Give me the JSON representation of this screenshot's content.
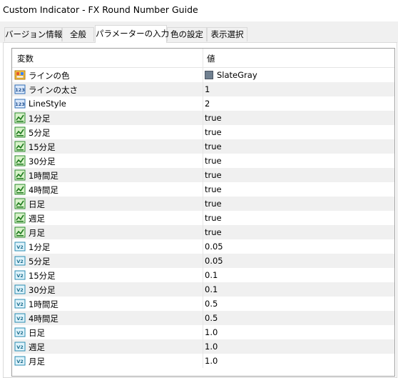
{
  "window": {
    "title": "Custom Indicator - FX Round Number Guide"
  },
  "tabs": [
    {
      "label": "バージョン情報"
    },
    {
      "label": "全般"
    },
    {
      "label": "パラメーターの入力"
    },
    {
      "label": "色の設定"
    },
    {
      "label": "表示選択"
    }
  ],
  "table": {
    "col_variable": "変数",
    "col_value": "値",
    "rows": [
      {
        "name": "ラインの色",
        "value": "SlateGray",
        "icon": "color-icon",
        "swatch": "#708090"
      },
      {
        "name": "ラインの太さ",
        "value": "1",
        "icon": "integer-icon"
      },
      {
        "name": "LineStyle",
        "value": "2",
        "icon": "integer-icon"
      },
      {
        "name": "1分足",
        "value": "true",
        "icon": "boolean-icon"
      },
      {
        "name": "5分足",
        "value": "true",
        "icon": "boolean-icon"
      },
      {
        "name": "15分足",
        "value": "true",
        "icon": "boolean-icon"
      },
      {
        "name": "30分足",
        "value": "true",
        "icon": "boolean-icon"
      },
      {
        "name": "1時間足",
        "value": "true",
        "icon": "boolean-icon"
      },
      {
        "name": "4時間足",
        "value": "true",
        "icon": "boolean-icon"
      },
      {
        "name": "日足",
        "value": "true",
        "icon": "boolean-icon"
      },
      {
        "name": "週足",
        "value": "true",
        "icon": "boolean-icon"
      },
      {
        "name": "月足",
        "value": "true",
        "icon": "boolean-icon"
      },
      {
        "name": "1分足",
        "value": "0.05",
        "icon": "double-icon"
      },
      {
        "name": "5分足",
        "value": "0.05",
        "icon": "double-icon"
      },
      {
        "name": "15分足",
        "value": "0.1",
        "icon": "double-icon"
      },
      {
        "name": "30分足",
        "value": "0.1",
        "icon": "double-icon"
      },
      {
        "name": "1時間足",
        "value": "0.5",
        "icon": "double-icon"
      },
      {
        "name": "4時間足",
        "value": "0.5",
        "icon": "double-icon"
      },
      {
        "name": "日足",
        "value": "1.0",
        "icon": "double-icon"
      },
      {
        "name": "週足",
        "value": "1.0",
        "icon": "double-icon"
      },
      {
        "name": "月足",
        "value": "1.0",
        "icon": "double-icon"
      }
    ]
  }
}
